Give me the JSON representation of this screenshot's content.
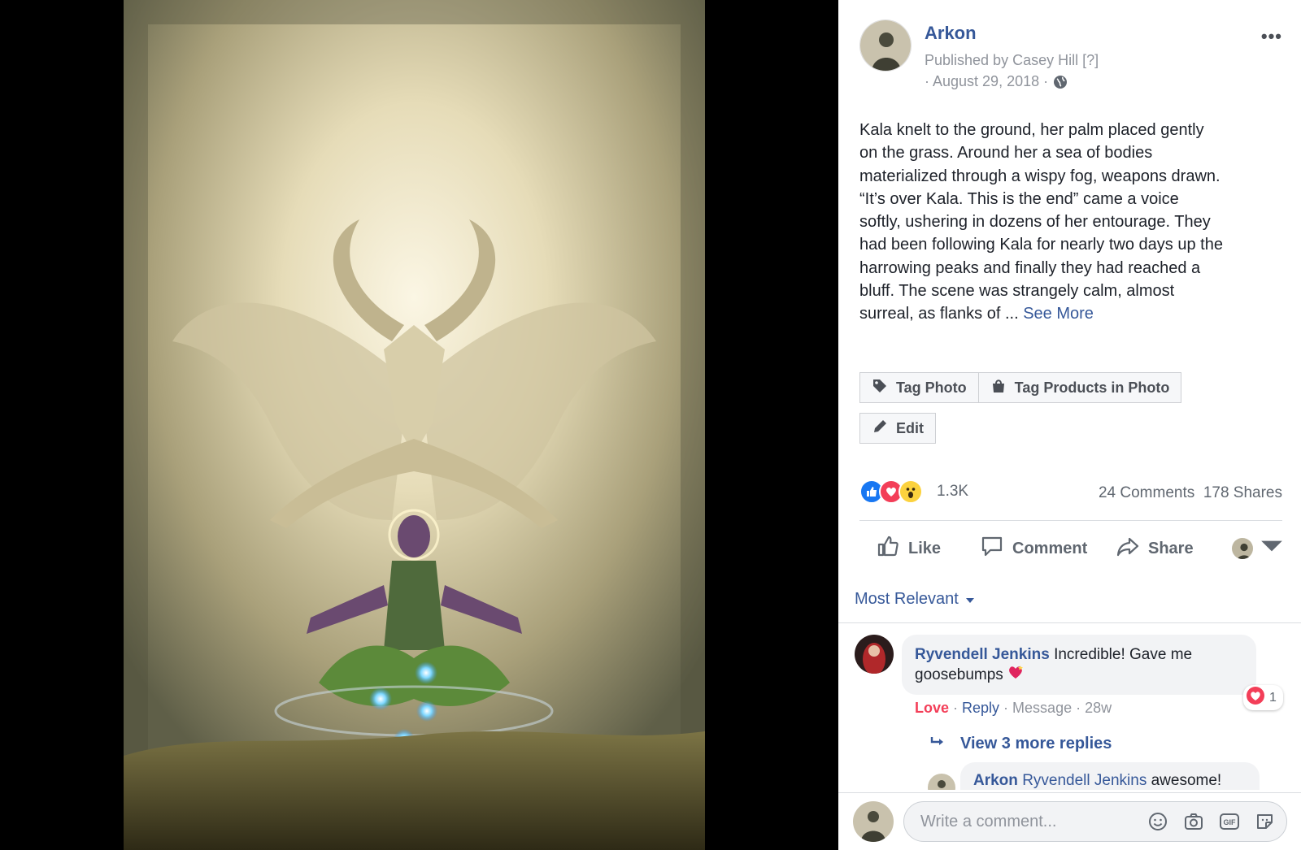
{
  "post": {
    "page_name": "Arkon",
    "published_by": "Published by Casey Hill",
    "published_help": "[?]",
    "date": "· August 29, 2018 ·",
    "more": "•••",
    "text_lines": [
      "Kala knelt to the ground, her palm placed gently",
      "on the grass. Around her a sea of bodies",
      "materialized through a wispy fog, weapons drawn.",
      "“It’s over Kala. This is the end” came a voice",
      "softly, ushering in dozens of her entourage. They",
      "had been following Kala for nearly two days up the",
      "harrowing peaks and finally they had reached a",
      "bluff. The scene was strangely calm, almost",
      "surreal, as flanks of ..."
    ],
    "see_more": "See More"
  },
  "buttons": {
    "tag_photo": "Tag Photo",
    "tag_products": "Tag Products in Photo",
    "edit": "Edit"
  },
  "stats": {
    "reactions": "1.3K",
    "comments": "24 Comments",
    "shares": "178 Shares",
    "reaction_types": [
      "like",
      "love",
      "wow"
    ]
  },
  "actions": {
    "like": "Like",
    "comment": "Comment",
    "share": "Share"
  },
  "sort": {
    "label": "Most Relevant"
  },
  "comment": {
    "author": "Ryvendell Jenkins",
    "text_line1": "Incredible! Gave me",
    "text_line2": "goosebumps",
    "reaction_count": "1",
    "love": "Love",
    "sep1": " · ",
    "reply": "Reply",
    "sep2": " · ",
    "message": "Message",
    "sep3": " · ",
    "age": "28w"
  },
  "replies": {
    "view_more": "View 3 more replies",
    "reply_author": "Arkon",
    "reply_mention": "Ryvendell Jenkins",
    "reply_text": "awesome!"
  },
  "composer": {
    "placeholder": "Write a comment..."
  },
  "colors": {
    "link_blue": "#365899",
    "love_red": "#f33e58",
    "like_blue": "#1877f2"
  }
}
